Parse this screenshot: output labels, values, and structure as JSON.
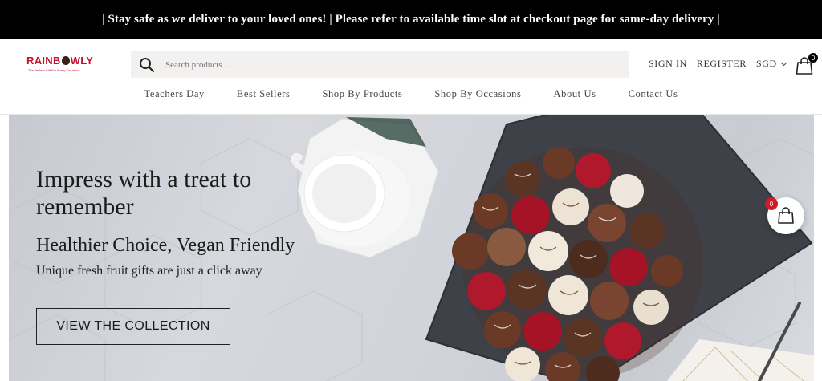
{
  "announcement": {
    "text": "| Stay safe as we deliver to your loved ones! | Please refer to available time slot at checkout page for same-day delivery |"
  },
  "header": {
    "logo_text_left": "RAINB",
    "logo_text_right": "WLY",
    "logo_tagline": "The Perfect Gift For Every Occasion",
    "search": {
      "placeholder": "Search products ..."
    },
    "sign_in": "SIGN IN",
    "register": "REGISTER",
    "currency": "SGD",
    "cart_count": "0"
  },
  "nav": {
    "items": [
      {
        "label": "Teachers Day"
      },
      {
        "label": "Best Sellers"
      },
      {
        "label": "Shop By Products"
      },
      {
        "label": "Shop By Occasions"
      },
      {
        "label": "About Us"
      },
      {
        "label": "Contact Us"
      }
    ]
  },
  "hero": {
    "title": "Impress with a treat to remember",
    "subtitle": "Healthier Choice, Vegan Friendly",
    "description": "Unique fresh fruit gifts are just a click away",
    "button_label": "VIEW THE COLLECTION"
  },
  "floating_cart": {
    "count": "0"
  },
  "colors": {
    "brand_red": "#c8102e",
    "announcement_bg": "#000000",
    "badge_red": "#d11a2a"
  }
}
